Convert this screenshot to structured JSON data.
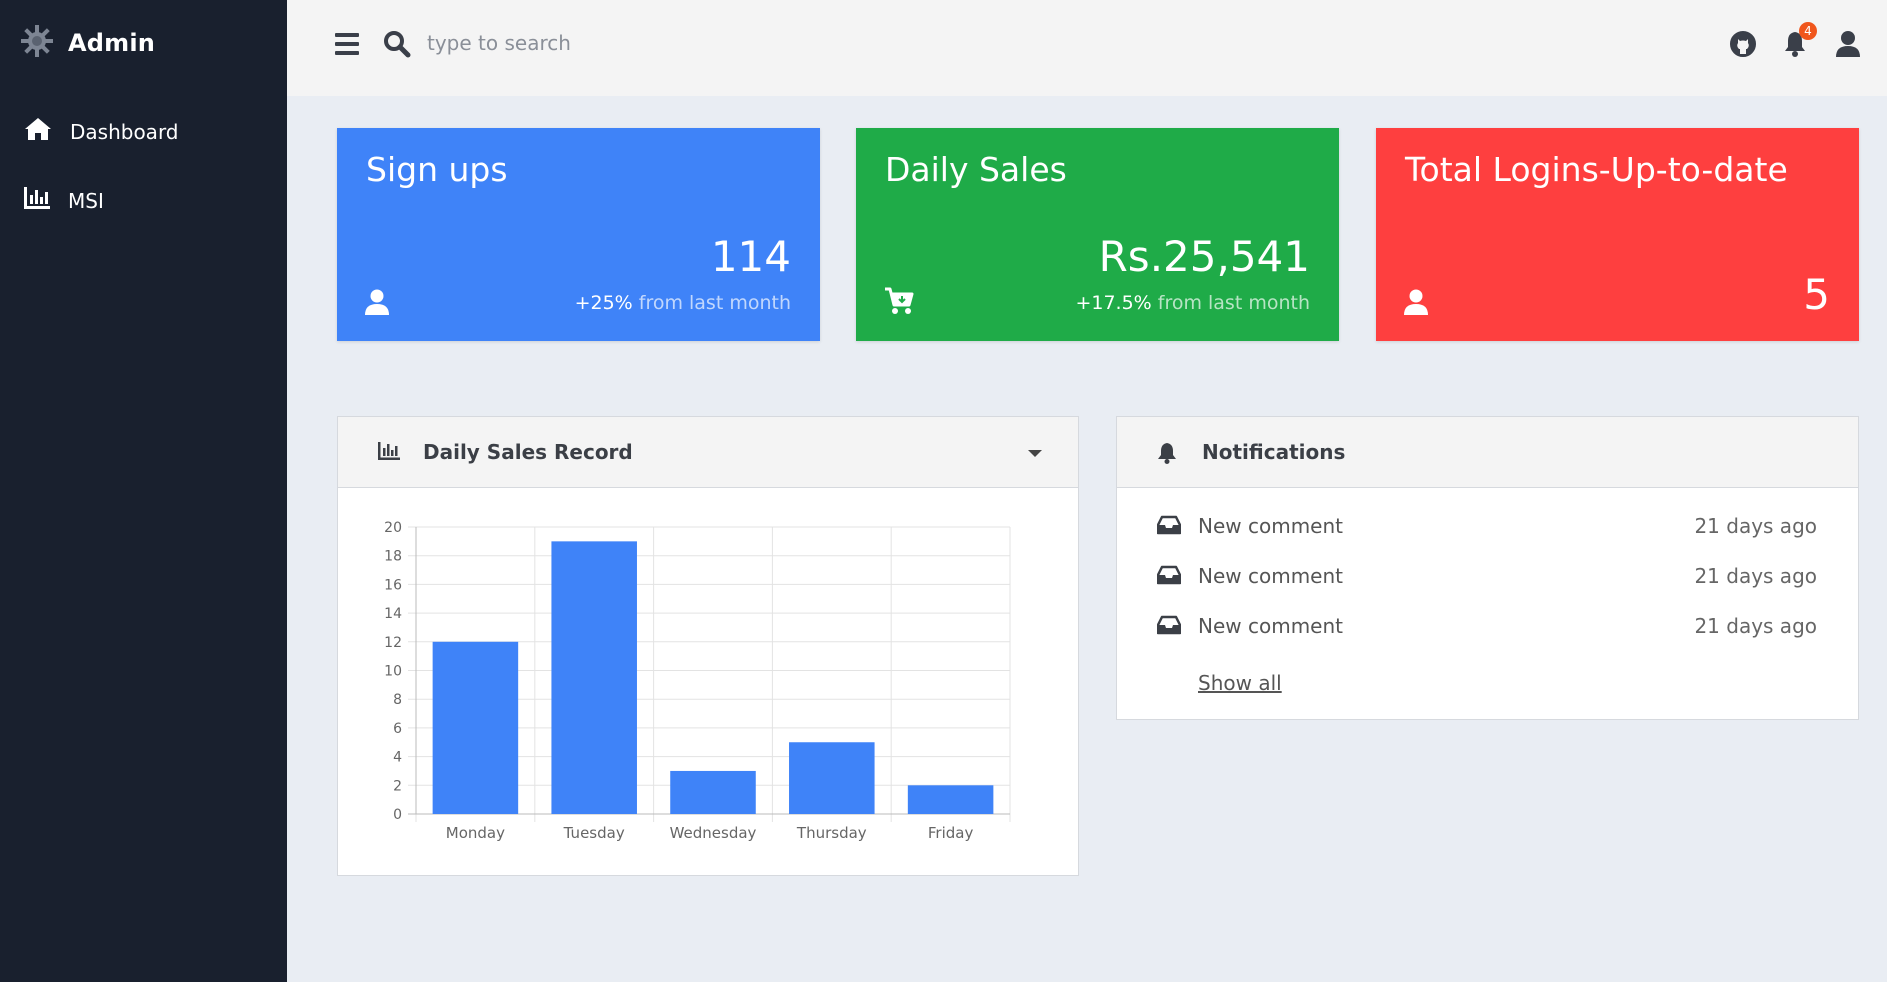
{
  "sidebar": {
    "brand": "Admin",
    "items": [
      {
        "label": "Dashboard",
        "icon": "home-icon"
      },
      {
        "label": "MSI",
        "icon": "bar-chart-icon"
      }
    ]
  },
  "topbar": {
    "search_placeholder": "type to search",
    "notification_count": "4"
  },
  "cards": [
    {
      "title": "Sign ups",
      "value": "114",
      "change": "+25%",
      "change_text": " from last month",
      "color": "#3f83f8",
      "icon": "user-icon"
    },
    {
      "title": "Daily Sales",
      "value": "Rs.25,541",
      "change": "+17.5%",
      "change_text": " from last month",
      "color": "#1fab48",
      "icon": "cart-icon"
    },
    {
      "title": "Total Logins-Up-to-date",
      "value": "5",
      "color": "#fe3f3f",
      "icon": "user-icon"
    }
  ],
  "sales_panel": {
    "title": "Daily Sales Record"
  },
  "chart_data": {
    "type": "bar",
    "categories": [
      "Monday",
      "Tuesday",
      "Wednesday",
      "Thursday",
      "Friday"
    ],
    "values": [
      12,
      19,
      3,
      5,
      2
    ],
    "ylim": [
      0,
      20
    ],
    "yticks": [
      0,
      2,
      4,
      6,
      8,
      10,
      12,
      14,
      16,
      18,
      20
    ],
    "grid": true,
    "bar_color": "#3f83f8"
  },
  "notifications": {
    "title": "Notifications",
    "items": [
      {
        "text": "New comment",
        "time": "21 days ago"
      },
      {
        "text": "New comment",
        "time": "21 days ago"
      },
      {
        "text": "New comment",
        "time": "21 days ago"
      }
    ],
    "show_all": "Show all"
  }
}
